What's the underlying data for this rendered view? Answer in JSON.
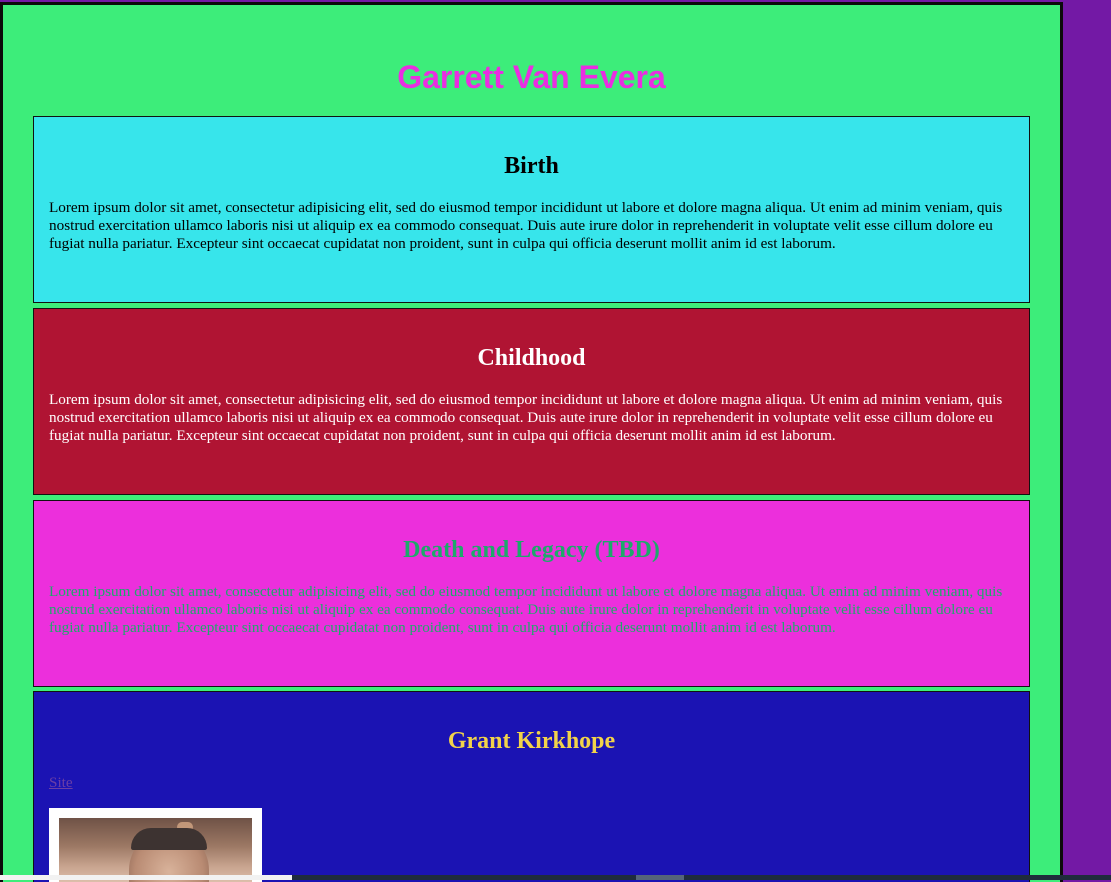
{
  "page": {
    "title": "Garrett Van Evera"
  },
  "sections": {
    "birth": {
      "heading": "Birth",
      "text": "Lorem ipsum dolor sit amet, consectetur adipisicing elit, sed do eiusmod tempor incididunt ut labore et dolore magna aliqua. Ut enim ad minim veniam, quis nostrud exercitation ullamco laboris nisi ut aliquip ex ea commodo consequat. Duis aute irure dolor in reprehenderit in voluptate velit esse cillum dolore eu fugiat nulla pariatur. Excepteur sint occaecat cupidatat non proident, sunt in culpa qui officia deserunt mollit anim id est laborum."
    },
    "childhood": {
      "heading": "Childhood",
      "text": "Lorem ipsum dolor sit amet, consectetur adipisicing elit, sed do eiusmod tempor incididunt ut labore et dolore magna aliqua. Ut enim ad minim veniam, quis nostrud exercitation ullamco laboris nisi ut aliquip ex ea commodo consequat. Duis aute irure dolor in reprehenderit in voluptate velit esse cillum dolore eu fugiat nulla pariatur. Excepteur sint occaecat cupidatat non proident, sunt in culpa qui officia deserunt mollit anim id est laborum."
    },
    "death": {
      "heading": "Death and Legacy (TBD)",
      "text": "Lorem ipsum dolor sit amet, consectetur adipisicing elit, sed do eiusmod tempor incididunt ut labore et dolore magna aliqua. Ut enim ad minim veniam, quis nostrud exercitation ullamco laboris nisi ut aliquip ex ea commodo consequat. Duis aute irure dolor in reprehenderit in voluptate velit esse cillum dolore eu fugiat nulla pariatur. Excepteur sint occaecat cupidatat non proident, sunt in culpa qui officia deserunt mollit anim id est laborum."
    },
    "grant": {
      "heading": "Grant Kirkhope",
      "link_label": "Site"
    }
  },
  "colors": {
    "page_background": "#3ded7a",
    "outer_background": "#7319a5",
    "title": "#e92ee1",
    "birth_bg": "#37e5eb",
    "childhood_bg": "#b01433",
    "death_bg": "#ec2fdc",
    "death_text": "#1ea86b",
    "grant_bg": "#1b13b3",
    "grant_heading": "#f2d34a"
  }
}
